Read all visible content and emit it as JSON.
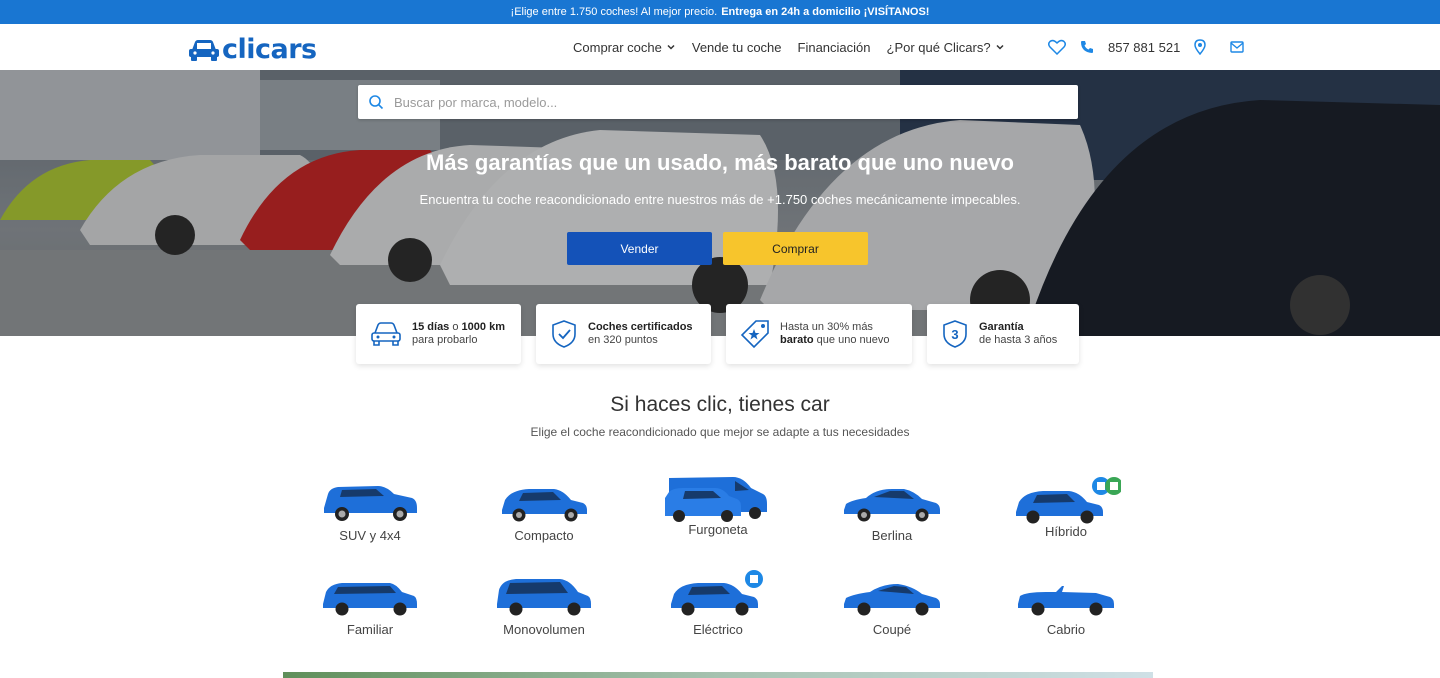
{
  "topbar": {
    "text_plain": "¡Elige entre 1.750 coches! Al mejor precio.",
    "text_bold": "Entrega en 24h a domicilio ¡VISÍTANOS!"
  },
  "header": {
    "logo": "clicars",
    "nav": [
      {
        "label": "Comprar coche",
        "dropdown": true
      },
      {
        "label": "Vende tu coche",
        "dropdown": false
      },
      {
        "label": "Financiación",
        "dropdown": false
      },
      {
        "label": "¿Por qué Clicars?",
        "dropdown": true
      }
    ],
    "phone": "857 881 521",
    "icons": [
      "heart-icon",
      "phone-icon",
      "location-pin-icon",
      "mail-icon"
    ]
  },
  "search": {
    "placeholder": "Buscar por marca, modelo..."
  },
  "hero": {
    "title": "Más garantías que un usado, más barato que uno nuevo",
    "subtitle": "Encuentra tu coche reacondicionado entre nuestros más de +1.750 coches mecánicamente impecables.",
    "sell_button": "Vender",
    "buy_button": "Comprar"
  },
  "features": [
    {
      "icon": "car-front-icon",
      "line1_bold": "15 días",
      "line1_rest": " o ",
      "line1_bold2": "1000 km",
      "line2": "para probarlo"
    },
    {
      "icon": "shield-check-icon",
      "line1_bold": "Coches certificados",
      "line1_rest": "",
      "line1_bold2": "",
      "line2": "en 320 puntos"
    },
    {
      "icon": "price-tag-star-icon",
      "line1_bold": "",
      "line1_rest": "Hasta un 30% más",
      "line1_bold2": "",
      "line2_bold": "barato",
      "line2": " que uno nuevo"
    },
    {
      "icon": "shield-three-icon",
      "line1_bold": "Garantía",
      "line1_rest": "",
      "line1_bold2": "",
      "line2": "de hasta 3 años"
    }
  ],
  "section": {
    "title": "Si haces clic, tienes car",
    "subtitle": "Elige el coche reacondicionado que mejor se adapte a tus necesidades"
  },
  "categories": [
    {
      "label": "SUV y 4x4",
      "icon": "suv-icon"
    },
    {
      "label": "Compacto",
      "icon": "compact-car-icon"
    },
    {
      "label": "Furgoneta",
      "icon": "van-icon"
    },
    {
      "label": "Berlina",
      "icon": "sedan-icon"
    },
    {
      "label": "Híbrido",
      "icon": "hybrid-car-icon"
    },
    {
      "label": "Familiar",
      "icon": "estate-car-icon"
    },
    {
      "label": "Monovolumen",
      "icon": "minivan-icon"
    },
    {
      "label": "Eléctrico",
      "icon": "electric-car-icon"
    },
    {
      "label": "Coupé",
      "icon": "coupe-icon"
    },
    {
      "label": "Cabrio",
      "icon": "convertible-icon"
    }
  ],
  "colors": {
    "brand_blue": "#1565c0",
    "topbar_blue": "#1976d2",
    "sell_button": "#1452b8",
    "buy_button": "#f7c52c",
    "car_blue": "#1e6fd9"
  }
}
